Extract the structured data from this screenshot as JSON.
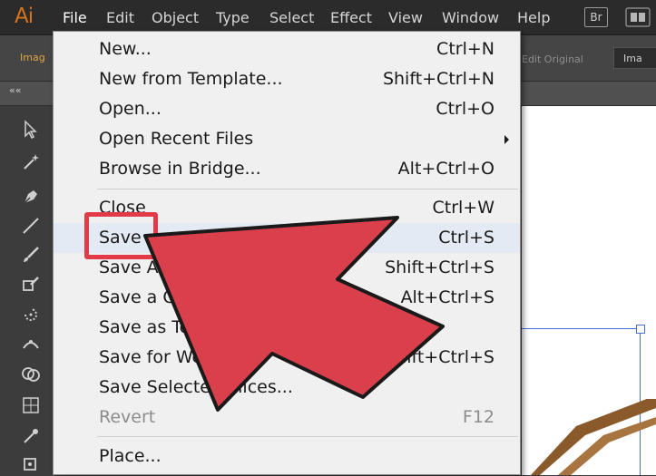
{
  "app": {
    "logo": "Ai"
  },
  "menubar": {
    "items": [
      "File",
      "Edit",
      "Object",
      "Type",
      "Select",
      "Effect",
      "View",
      "Window",
      "Help"
    ],
    "active": "File",
    "bridge_label": "Br"
  },
  "controlbar": {
    "left_text": "Imag",
    "edit_original": "Edit Original",
    "right_button": "Ima"
  },
  "panelbar": {
    "collapse": "««"
  },
  "file_menu": {
    "items": [
      {
        "label": "New...",
        "shortcut": "Ctrl+N"
      },
      {
        "label": "New from Template...",
        "shortcut": "Shift+Ctrl+N"
      },
      {
        "label": "Open...",
        "shortcut": "Ctrl+O"
      },
      {
        "label": "Open Recent Files",
        "shortcut": ""
      },
      {
        "label": "Browse in Bridge...",
        "shortcut": "Alt+Ctrl+O"
      },
      {
        "label": "Close",
        "shortcut": "Ctrl+W"
      },
      {
        "label": "Save",
        "shortcut": "Ctrl+S"
      },
      {
        "label": "Save As...",
        "shortcut": "Shift+Ctrl+S"
      },
      {
        "label": "Save a Copy...",
        "shortcut": "Alt+Ctrl+S"
      },
      {
        "label": "Save as Template...",
        "shortcut": ""
      },
      {
        "label": "Save for Web...",
        "shortcut": "Alt+Shift+Ctrl+S"
      },
      {
        "label": "Save Selected Slices...",
        "shortcut": ""
      },
      {
        "label": "Revert",
        "shortcut": "F12"
      },
      {
        "label": "Place...",
        "shortcut": ""
      }
    ]
  },
  "annotation": {
    "highlight_color": "#e23b47",
    "arrow_color": "#d9404c"
  },
  "colors": {
    "menubar": "#2b2b2b",
    "menu_bg": "#f0f0f0",
    "accent": "#d4741c"
  }
}
